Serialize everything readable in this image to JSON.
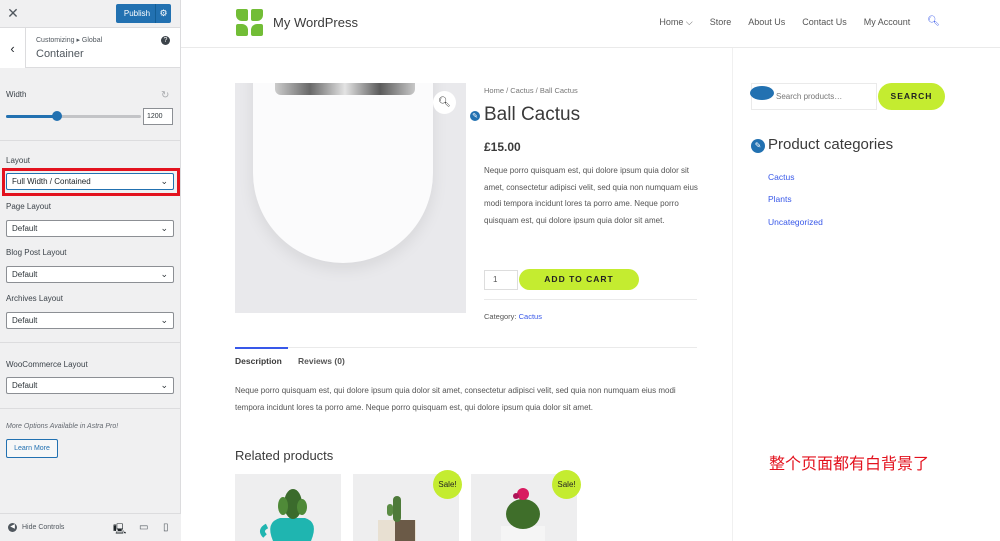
{
  "customizer": {
    "close_icon": "close-icon",
    "publish_label": "Publish",
    "breadcrumb": "Customizing ▸ Global",
    "section_title": "Container",
    "width_label": "Width",
    "width_value": "1200",
    "width_slider_fraction": 0.4,
    "layout_label": "Layout",
    "layout_value": "Full Width / Contained",
    "page_layout_label": "Page Layout",
    "page_layout_value": "Default",
    "blog_layout_label": "Blog Post Layout",
    "blog_layout_value": "Default",
    "archives_layout_label": "Archives Layout",
    "archives_layout_value": "Default",
    "woo_layout_label": "WooCommerce Layout",
    "woo_layout_value": "Default",
    "more_options": "More Options Available in Astra Pro!",
    "learn_more": "Learn More",
    "hide_controls": "Hide Controls"
  },
  "site": {
    "title": "My WordPress",
    "menu": [
      "Home",
      "Store",
      "About Us",
      "Contact Us",
      "My Account"
    ],
    "breadcrumb": "Home / Cactus / Ball Cactus",
    "product_title": "Ball Cactus",
    "price": "£15.00",
    "short_description": "Neque porro quisquam est, qui dolore ipsum quia dolor sit amet, consectetur adipisci velit, sed quia non numquam eius modi tempora incidunt lores ta porro ame. Neque porro quisquam est, qui dolore ipsum quia dolor sit amet.",
    "quantity": "1",
    "add_to_cart": "ADD TO CART",
    "category_label": "Category:",
    "category_value": "Cactus",
    "tab_description": "Description",
    "tab_reviews": "Reviews (0)",
    "long_description": "Neque porro quisquam est, qui dolore ipsum quia dolor sit amet, consectetur adipisci velit, sed quia non numquam eius modi tempora incidunt lores ta porro ame. Neque porro quisquam est, qui dolore ipsum quia dolor sit amet.",
    "related_title": "Related products",
    "sale_badge": "Sale!",
    "search_placeholder": "Search products…",
    "search_button": "SEARCH",
    "categories_title": "Product categories",
    "categories": [
      "Cactus",
      "Plants",
      "Uncategorized"
    ]
  },
  "annotation": {
    "note": "整个页面都有白背景了",
    "color": "#e3121e"
  },
  "colors": {
    "wp_blue": "#2271b1",
    "accent_green": "#c4ec30",
    "link_blue": "#3858e9"
  }
}
